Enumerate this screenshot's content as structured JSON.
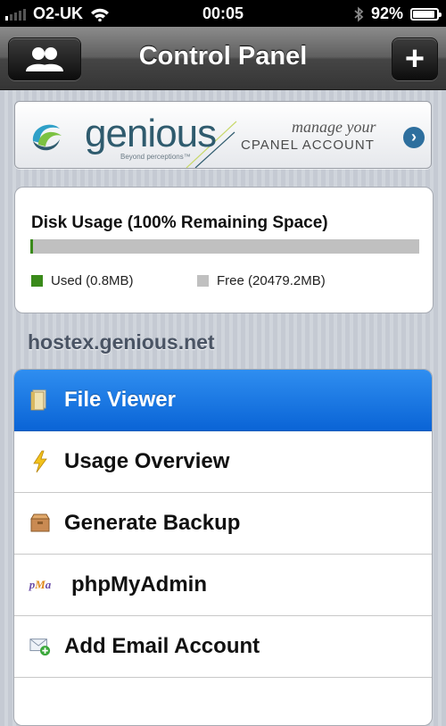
{
  "status_bar": {
    "carrier": "O2-UK",
    "time": "00:05",
    "battery_percent": "92%",
    "battery_level": 0.92,
    "signal_bars_on": 1,
    "signal_bars_total": 5
  },
  "nav": {
    "title": "Control Panel",
    "add_label": "+"
  },
  "banner": {
    "brand": "genious",
    "tagline": "Beyond perceptions™",
    "manage_text": "manage your",
    "cpanel_text": "CPANEL ACCOUNT",
    "arrow_glyph": "›"
  },
  "disk": {
    "heading": "Disk Usage (100% Remaining Space)",
    "used_label": "Used (0.8MB)",
    "free_label": "Free (20479.2MB)",
    "used_fraction": 0.004,
    "used_color": "#3a8a1a",
    "free_color": "#c0c0c0"
  },
  "domain": "hostex.genious.net",
  "menu": {
    "items": [
      {
        "label": "File Viewer",
        "icon": "folder-icon",
        "selected": true
      },
      {
        "label": "Usage Overview",
        "icon": "lightning-icon",
        "selected": false
      },
      {
        "label": "Generate Backup",
        "icon": "backup-box-icon",
        "selected": false
      },
      {
        "label": "phpMyAdmin",
        "icon": "phpmyadmin-icon",
        "selected": false
      },
      {
        "label": "Add Email Account",
        "icon": "add-email-icon",
        "selected": false
      }
    ]
  },
  "colors": {
    "accent_blue": "#0a64d6",
    "nav_dark": "#353535"
  }
}
